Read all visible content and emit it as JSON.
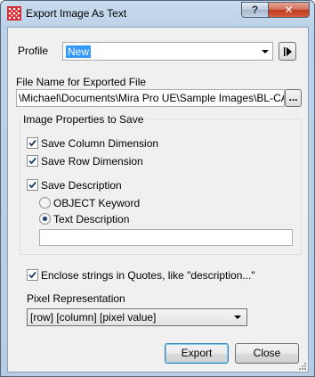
{
  "window": {
    "title": "Export Image As Text",
    "help_label": "?",
    "close_label": "✕"
  },
  "profile": {
    "label": "Profile",
    "value": "New"
  },
  "file": {
    "label": "File Name for Exported File",
    "value": "\\Michael\\Documents\\Mira Pro UE\\Sample Images\\BL-CAM.txt",
    "browse_label": "..."
  },
  "image_props": {
    "title": "Image Properties to Save",
    "save_column_dimension": {
      "label": "Save Column Dimension",
      "checked": true
    },
    "save_row_dimension": {
      "label": "Save Row Dimension",
      "checked": true
    },
    "save_description": {
      "label": "Save Description",
      "checked": true
    },
    "object_keyword": {
      "label": "OBJECT Keyword",
      "selected": false
    },
    "text_description": {
      "label": "Text Description",
      "selected": true
    },
    "description_value": ""
  },
  "enclose": {
    "label": "Enclose strings in Quotes, like \"description...\"",
    "checked": true
  },
  "pixel": {
    "label": "Pixel Representation",
    "value": "[row]  [column]  [pixel value]"
  },
  "buttons": {
    "export": "Export",
    "close": "Close"
  },
  "colors": {
    "selection": "#3399ff",
    "title_gradient": "#bcd2e8",
    "close_red": "#c0391b"
  },
  "icons": [
    "app-logo-icon",
    "help-icon",
    "close-icon",
    "play-arrow-icon",
    "chevron-down-icon",
    "checkmark-icon",
    "resize-grip-icon"
  ]
}
